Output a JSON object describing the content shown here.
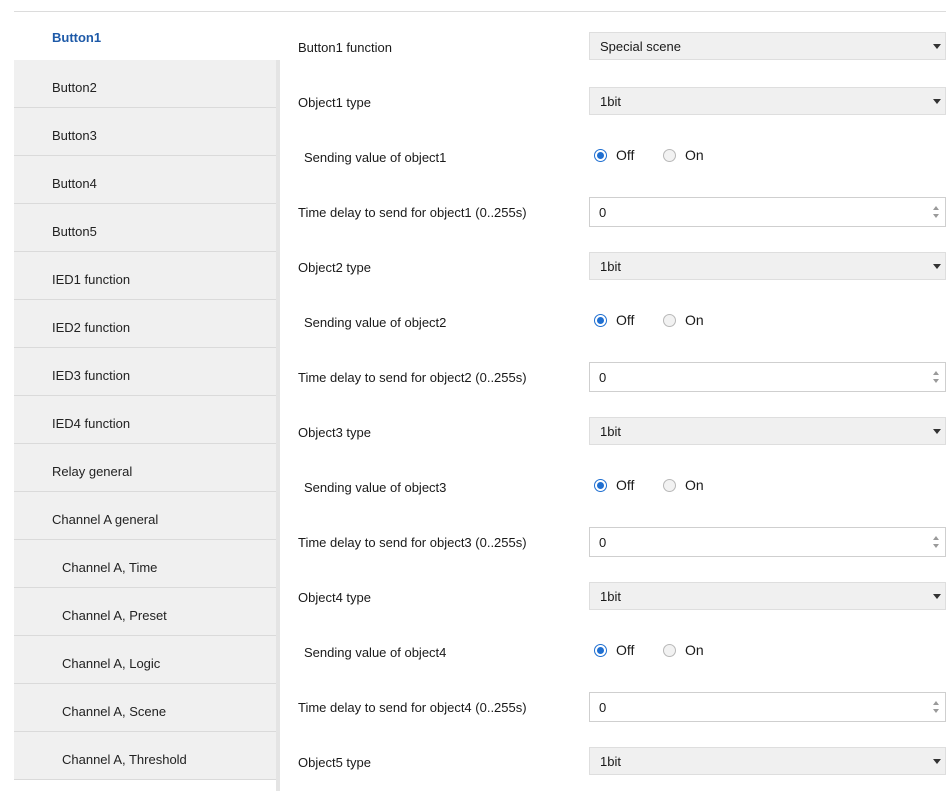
{
  "sidebar": {
    "items": [
      {
        "label": "Button1"
      },
      {
        "label": "Button2"
      },
      {
        "label": "Button3"
      },
      {
        "label": "Button4"
      },
      {
        "label": "Button5"
      },
      {
        "label": "IED1 function"
      },
      {
        "label": "IED2 function"
      },
      {
        "label": "IED3 function"
      },
      {
        "label": "IED4 function"
      },
      {
        "label": "Relay general"
      },
      {
        "label": "Channel A general"
      },
      {
        "label": "Channel A, Time"
      },
      {
        "label": "Channel A, Preset"
      },
      {
        "label": "Channel A, Logic"
      },
      {
        "label": "Channel A, Scene"
      },
      {
        "label": "Channel A, Threshold"
      }
    ],
    "active_index": 0
  },
  "params": {
    "button1_function": {
      "label": "Button1 function",
      "value": "Special scene"
    },
    "object1_type": {
      "label": "Object1 type",
      "value": "1bit"
    },
    "object1_send": {
      "label": "Sending value of object1",
      "options": [
        "Off",
        "On"
      ],
      "selected": "Off"
    },
    "object1_delay": {
      "label": "Time delay to send for object1 (0..255s)",
      "value": "0"
    },
    "object2_type": {
      "label": "Object2 type",
      "value": "1bit"
    },
    "object2_send": {
      "label": "Sending value of object2",
      "options": [
        "Off",
        "On"
      ],
      "selected": "Off"
    },
    "object2_delay": {
      "label": "Time delay to send for object2 (0..255s)",
      "value": "0"
    },
    "object3_type": {
      "label": "Object3 type",
      "value": "1bit"
    },
    "object3_send": {
      "label": "Sending value of object3",
      "options": [
        "Off",
        "On"
      ],
      "selected": "Off"
    },
    "object3_delay": {
      "label": "Time delay to send for object3 (0..255s)",
      "value": "0"
    },
    "object4_type": {
      "label": "Object4 type",
      "value": "1bit"
    },
    "object4_send": {
      "label": "Sending value of object4",
      "options": [
        "Off",
        "On"
      ],
      "selected": "Off"
    },
    "object4_delay": {
      "label": "Time delay to send for object4 (0..255s)",
      "value": "0"
    },
    "object5_type": {
      "label": "Object5 type",
      "value": "1bit"
    }
  },
  "colors": {
    "accent": "#1f6fd1",
    "active_nav_text": "#1e5aa8",
    "nav_bg": "#f0f0f0",
    "select_bg": "#f0f0f0"
  }
}
